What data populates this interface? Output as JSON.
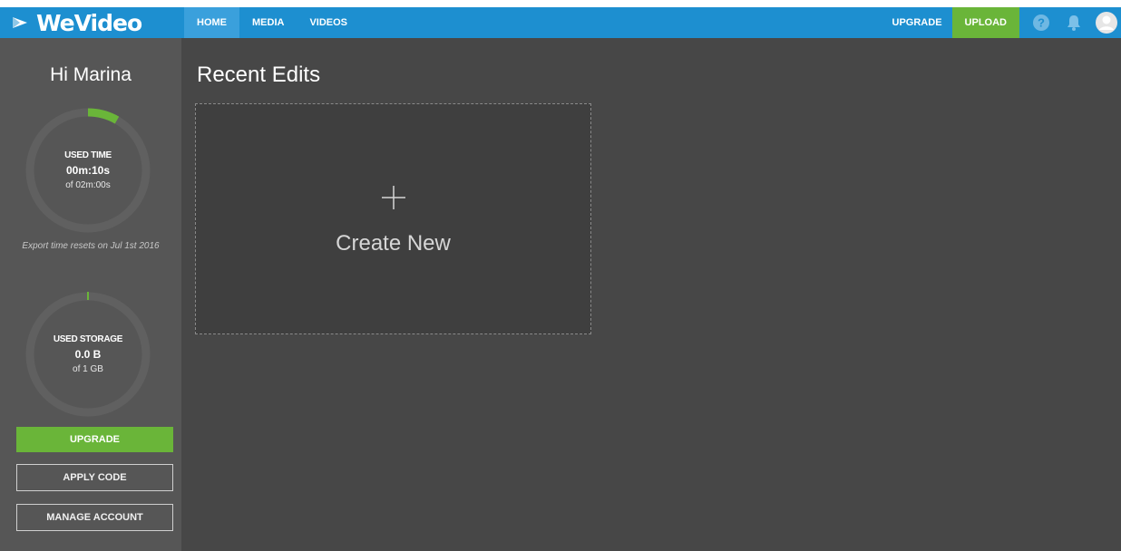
{
  "brand": {
    "name": "WeVideo"
  },
  "nav": {
    "tabs": [
      {
        "label": "HOME",
        "active": true
      },
      {
        "label": "MEDIA",
        "active": false
      },
      {
        "label": "VIDEOS",
        "active": false
      }
    ]
  },
  "header_actions": {
    "upgrade_label": "UPGRADE",
    "upload_label": "UPLOAD",
    "icons": [
      "help-icon",
      "bell-icon",
      "avatar-icon"
    ]
  },
  "sidebar": {
    "greeting": "Hi Marina",
    "used_time": {
      "label": "USED TIME",
      "value": "00m:10s",
      "of": "of 02m:00s",
      "fraction": 0.0833
    },
    "export_note": "Export time resets on Jul 1st 2016",
    "used_storage": {
      "label": "USED STORAGE",
      "value": "0.0 B",
      "of": "of 1 GB",
      "fraction": 0.0
    },
    "upgrade_label": "UPGRADE",
    "apply_code_label": "APPLY CODE",
    "manage_account_label": "MANAGE ACCOUNT"
  },
  "main": {
    "section_title": "Recent Edits",
    "create_label": "Create New"
  },
  "colors": {
    "topbar": "#1d8fd0",
    "accent_green": "#6ab539",
    "sidebar": "#565656",
    "main_bg": "#474747"
  }
}
